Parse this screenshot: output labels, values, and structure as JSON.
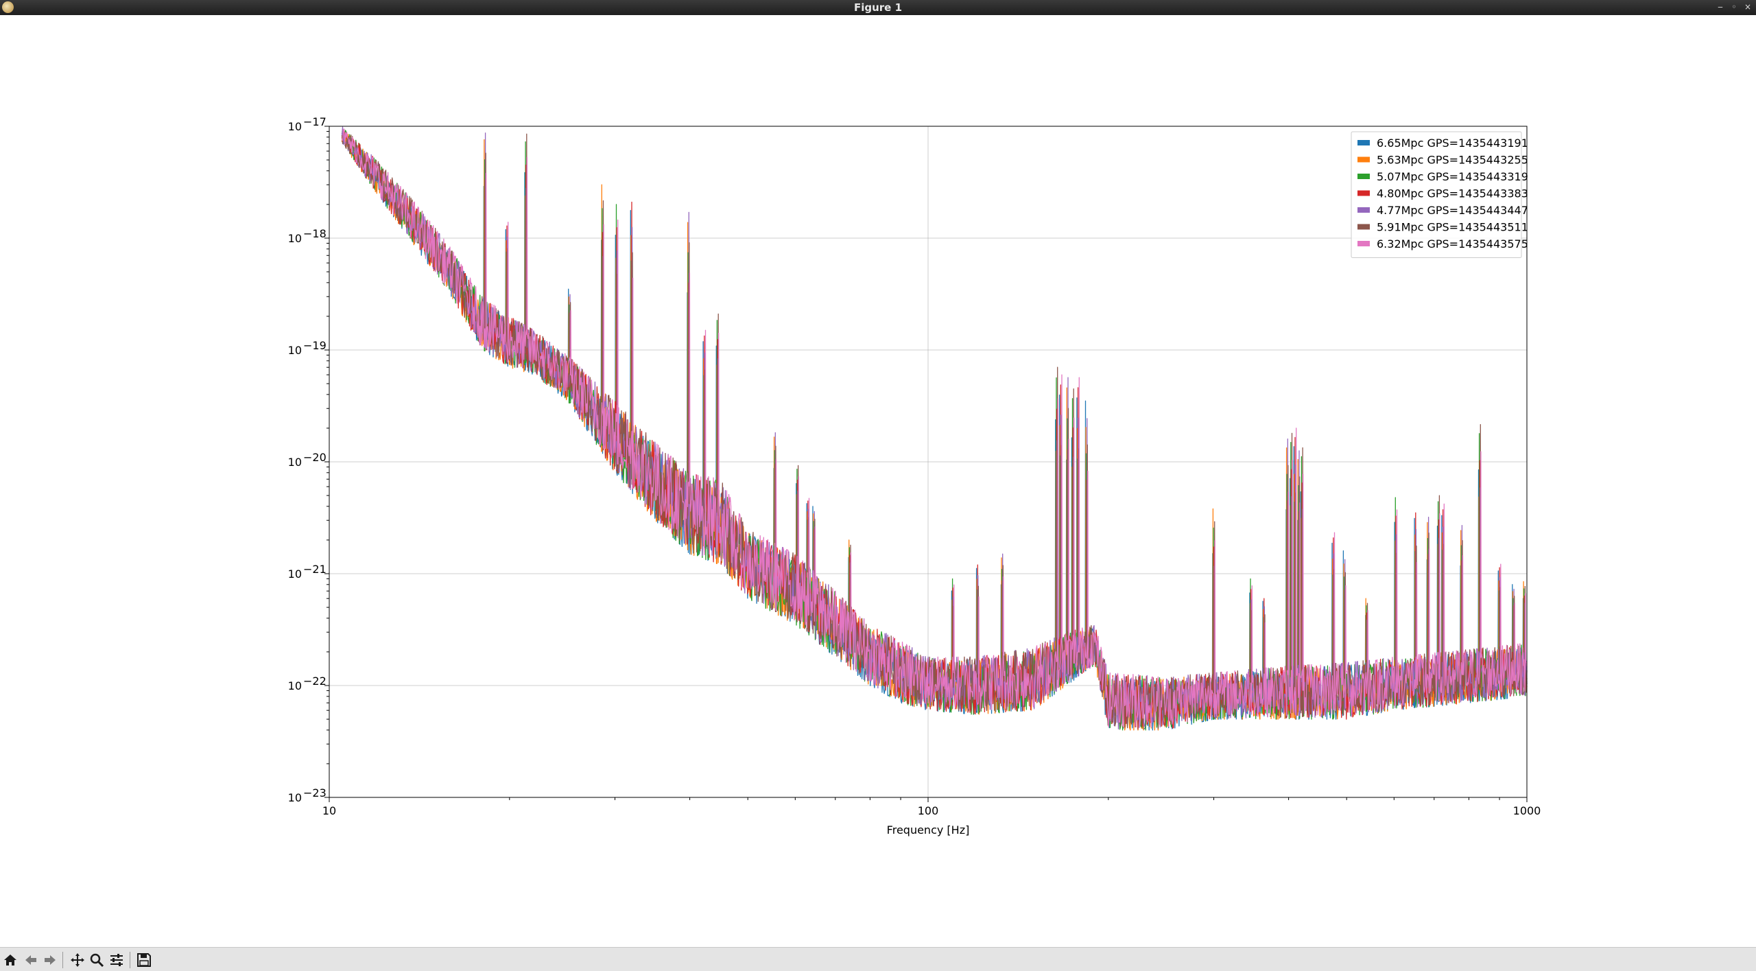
{
  "window": {
    "title": "Figure 1"
  },
  "toolbar": {
    "buttons": [
      {
        "name": "home-icon",
        "label": "Home"
      },
      {
        "name": "back-arrow-icon",
        "label": "Back"
      },
      {
        "name": "forward-arrow-icon",
        "label": "Forward"
      },
      {
        "name": "pan-icon",
        "label": "Pan"
      },
      {
        "name": "zoom-icon",
        "label": "Zoom"
      },
      {
        "name": "configure-icon",
        "label": "Configure subplots"
      },
      {
        "name": "save-icon",
        "label": "Save"
      }
    ]
  },
  "chart_data": {
    "type": "line",
    "title": "",
    "xlabel": "Frequency [Hz]",
    "ylabel": "",
    "xscale": "log",
    "yscale": "log",
    "xlim": [
      10,
      1000
    ],
    "ylim": [
      1e-23,
      1e-17
    ],
    "grid": true,
    "legend_position": "top-right",
    "x_ticks": [
      {
        "value": 10,
        "label": "10"
      },
      {
        "value": 100,
        "label": "100"
      },
      {
        "value": 1000,
        "label": "1000"
      }
    ],
    "y_ticks": [
      {
        "value": 1e-23,
        "base": "10",
        "exp": "−23"
      },
      {
        "value": 1e-22,
        "base": "10",
        "exp": "−22"
      },
      {
        "value": 1e-21,
        "base": "10",
        "exp": "−21"
      },
      {
        "value": 1e-20,
        "base": "10",
        "exp": "−20"
      },
      {
        "value": 1e-19,
        "base": "10",
        "exp": "−19"
      },
      {
        "value": 1e-18,
        "base": "10",
        "exp": "−18"
      },
      {
        "value": 1e-17,
        "base": "10",
        "exp": "−17"
      }
    ],
    "series": [
      {
        "name": "6.65Mpc GPS=1435443191",
        "color": "#1f77b4"
      },
      {
        "name": "5.63Mpc GPS=1435443255",
        "color": "#ff7f0e"
      },
      {
        "name": "5.07Mpc GPS=1435443319",
        "color": "#2ca02c"
      },
      {
        "name": "4.80Mpc GPS=1435443383",
        "color": "#d62728"
      },
      {
        "name": "4.77Mpc GPS=1435443447",
        "color": "#9467bd"
      },
      {
        "name": "5.91Mpc GPS=1435443511",
        "color": "#8c564b"
      },
      {
        "name": "6.32Mpc GPS=1435443575",
        "color": "#e377c2"
      }
    ],
    "envelope": {
      "description_points": "approximate lower/upper bounds of the spectral band",
      "points": [
        {
          "f": 10.5,
          "lo": 7e-18,
          "hi": 1e-17
        },
        {
          "f": 12,
          "lo": 2.5e-18,
          "hi": 5e-18
        },
        {
          "f": 14,
          "lo": 8e-19,
          "hi": 2e-18
        },
        {
          "f": 16,
          "lo": 3e-19,
          "hi": 8e-19
        },
        {
          "f": 18,
          "lo": 1e-19,
          "hi": 3e-19
        },
        {
          "f": 20,
          "lo": 7e-20,
          "hi": 2e-19
        },
        {
          "f": 22,
          "lo": 6e-20,
          "hi": 1.5e-19
        },
        {
          "f": 25,
          "lo": 3.5e-20,
          "hi": 9e-20
        },
        {
          "f": 30,
          "lo": 8e-21,
          "hi": 3.5e-20
        },
        {
          "f": 35,
          "lo": 3e-21,
          "hi": 1.5e-20
        },
        {
          "f": 40,
          "lo": 1.5e-21,
          "hi": 8e-21
        },
        {
          "f": 45,
          "lo": 1.2e-21,
          "hi": 7e-21
        },
        {
          "f": 50,
          "lo": 6e-22,
          "hi": 2.5e-21
        },
        {
          "f": 60,
          "lo": 3.5e-22,
          "hi": 1.5e-21
        },
        {
          "f": 70,
          "lo": 1.8e-22,
          "hi": 7e-22
        },
        {
          "f": 80,
          "lo": 1e-22,
          "hi": 3.5e-22
        },
        {
          "f": 90,
          "lo": 7e-23,
          "hi": 2.5e-22
        },
        {
          "f": 100,
          "lo": 6e-23,
          "hi": 1.8e-22
        },
        {
          "f": 120,
          "lo": 5.5e-23,
          "hi": 1.8e-22
        },
        {
          "f": 150,
          "lo": 6e-23,
          "hi": 2.2e-22
        },
        {
          "f": 170,
          "lo": 1e-22,
          "hi": 3e-22
        },
        {
          "f": 190,
          "lo": 1.5e-22,
          "hi": 3.5e-22
        },
        {
          "f": 200,
          "lo": 4e-23,
          "hi": 1.3e-22
        },
        {
          "f": 250,
          "lo": 4e-23,
          "hi": 1.2e-22
        },
        {
          "f": 300,
          "lo": 5e-23,
          "hi": 1.3e-22
        },
        {
          "f": 400,
          "lo": 5e-23,
          "hi": 1.5e-22
        },
        {
          "f": 500,
          "lo": 5e-23,
          "hi": 1.6e-22
        },
        {
          "f": 600,
          "lo": 6e-23,
          "hi": 1.8e-22
        },
        {
          "f": 800,
          "lo": 7e-23,
          "hi": 2.1e-22
        },
        {
          "f": 1000,
          "lo": 8e-23,
          "hi": 2.4e-22
        }
      ]
    },
    "peaks": [
      {
        "f": 18.2,
        "y": 1e-17
      },
      {
        "f": 21.3,
        "y": 1e-17
      },
      {
        "f": 19.8,
        "y": 1.5e-18
      },
      {
        "f": 25.2,
        "y": 3.5e-19
      },
      {
        "f": 28.6,
        "y": 3e-18
      },
      {
        "f": 30.2,
        "y": 2e-18
      },
      {
        "f": 32.0,
        "y": 2.1e-18
      },
      {
        "f": 39.8,
        "y": 1.7e-18
      },
      {
        "f": 44.5,
        "y": 2.1e-19
      },
      {
        "f": 42.3,
        "y": 1.5e-19
      },
      {
        "f": 55.5,
        "y": 2e-20
      },
      {
        "f": 60.5,
        "y": 1e-20
      },
      {
        "f": 63.0,
        "y": 5e-21
      },
      {
        "f": 64.5,
        "y": 4e-21
      },
      {
        "f": 74.0,
        "y": 2e-21
      },
      {
        "f": 110.0,
        "y": 9e-22
      },
      {
        "f": 121.0,
        "y": 1.2e-21
      },
      {
        "f": 133.0,
        "y": 1.5e-21
      },
      {
        "f": 164.0,
        "y": 7e-20
      },
      {
        "f": 166.5,
        "y": 6e-20
      },
      {
        "f": 171.0,
        "y": 7e-20
      },
      {
        "f": 174.5,
        "y": 5.5e-20
      },
      {
        "f": 178.0,
        "y": 7e-20
      },
      {
        "f": 184.0,
        "y": 3.5e-20
      },
      {
        "f": 300.0,
        "y": 3.8e-21
      },
      {
        "f": 346.0,
        "y": 9e-22
      },
      {
        "f": 364.0,
        "y": 6e-22
      },
      {
        "f": 398.0,
        "y": 1.6e-20
      },
      {
        "f": 404.0,
        "y": 1.8e-20
      },
      {
        "f": 410.0,
        "y": 2e-20
      },
      {
        "f": 416.0,
        "y": 1.5e-20
      },
      {
        "f": 421.0,
        "y": 1.6e-20
      },
      {
        "f": 475.0,
        "y": 2.6e-21
      },
      {
        "f": 496.0,
        "y": 1.6e-21
      },
      {
        "f": 540.0,
        "y": 6e-22
      },
      {
        "f": 604.0,
        "y": 4.8e-21
      },
      {
        "f": 652.0,
        "y": 3.5e-21
      },
      {
        "f": 684.0,
        "y": 3.2e-21
      },
      {
        "f": 712.0,
        "y": 5e-21
      },
      {
        "f": 724.0,
        "y": 4.2e-21
      },
      {
        "f": 778.0,
        "y": 3e-21
      },
      {
        "f": 834.0,
        "y": 2.6e-20
      },
      {
        "f": 900.0,
        "y": 1.3e-21
      },
      {
        "f": 950.0,
        "y": 8e-22
      },
      {
        "f": 990.0,
        "y": 8.5e-22
      }
    ]
  }
}
